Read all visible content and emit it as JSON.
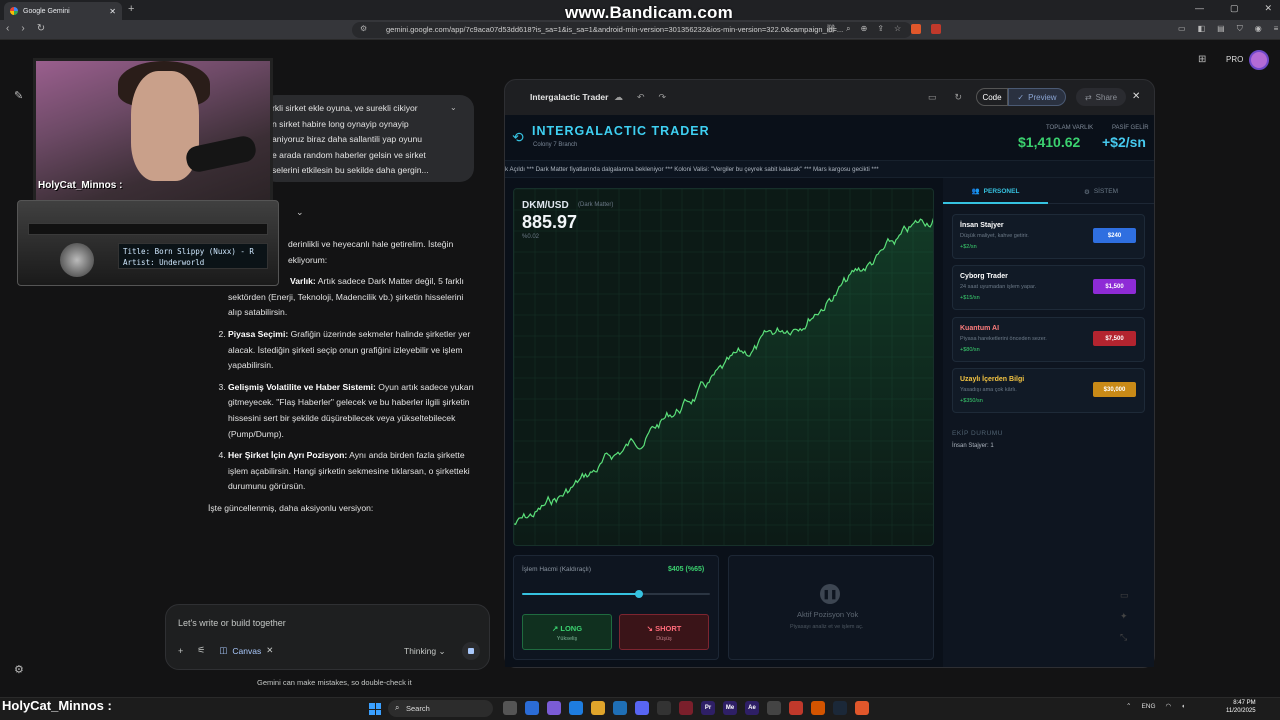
{
  "browser": {
    "tab_title": "Google Gemini",
    "url": "gemini.google.com/app/7c9aca07d53dd618?is_sa=1&is_sa=1&android-min-version=301356232&ios-min-version=322.0&campaign_id=...",
    "watermark": "www.Bandicam.com",
    "new_tab": "+",
    "close_tab": "✕"
  },
  "header": {
    "pro_label": "PRO"
  },
  "user_message": {
    "lines": [
      "rkli sirket ekle oyuna, ve surekli cikiyor",
      "n sirket habire long oynayip oynayip",
      "aniyoruz biraz daha sallantili yap oyunu",
      "e arada random haberler gelsin ve sirket",
      "selerini etkilesin bu sekilde daha gergin..."
    ]
  },
  "response": {
    "intro_1": "derinlikli ve heyecanlı hale getirelim. İsteğin",
    "intro_2": "ekliyorum:",
    "item1_bold": "Varlık:",
    "item1_text": "Artık sadece Dark Matter değil, 5 farklı sektörden (Enerji, Teknoloji, Madencilik vb.) şirketin hisselerini alıp satabilirsin.",
    "item2_bold": "Piyasa Seçimi:",
    "item2_text": "Grafiğin üzerinde sekmeler halinde şirketler yer alacak. İstediğin şirketi seçip onun grafiğini izleyebilir ve işlem yapabilirsin.",
    "item3_bold": "Gelişmiş Volatilite ve Haber Sistemi:",
    "item3_text": "Oyun artık sadece yukarı gitmeyecek. \"Flaş Haberler\" gelecek ve bu haberler ilgili şirketin hissesini sert bir şekilde düşürebilecek veya yükseltebilecek (Pump/Dump).",
    "item4_bold": "Her Şirket İçin Ayrı Pozisyon:",
    "item4_text": "Aynı anda birden fazla şirkette işlem açabilirsin. Hangi şirketin sekmesine tıklarsan, o şirketteki durumunu görürsün.",
    "outro": "İşte güncellenmiş, daha aksiyonlu versiyon:"
  },
  "prompt": {
    "placeholder": "Let's write or build together",
    "canvas_label": "Canvas",
    "thinking_label": "Thinking",
    "disclaimer": "Gemini can make mistakes, so double-check it"
  },
  "webcam": {
    "name": "HolyCat_Minnos :",
    "radio_title": "Title: Born Slippy (Nuxx) - R",
    "radio_artist": "Artist: Underworld"
  },
  "canvas_panel": {
    "title": "Intergalactic Trader",
    "code_label": "Code",
    "preview_label": "Preview",
    "share_label": "Share"
  },
  "game": {
    "title": "INTERGALACTIC TRADER",
    "subtitle": "Colony 7 Branch",
    "total_label": "TOPLAM VARLIK",
    "total_value": "$1,410.62",
    "passive_label": "PASİF GELİR",
    "passive_value": "+$2/sn",
    "ticker": "k Açıldı *** Dark Matter fiyatlarında dalgalanma bekleniyor *** Koloni Valisi: \"Vergiler bu çeyrek sabit kalacak\" *** Mars kargosu gecikti ***",
    "chart": {
      "symbol": "DKM/USD",
      "symbol_sub": "(Dark Matter)",
      "price": "885.97",
      "change": "%0.02"
    },
    "trade": {
      "volume_label": "İşlem Hacmi (Kaldıraçlı)",
      "volume_value": "$405 (%65)",
      "volume_fraction": 0.62,
      "long_label": "LONG",
      "long_sub": "Yükseliş",
      "short_label": "SHORT",
      "short_sub": "Düşüş"
    },
    "position": {
      "title": "Aktif Pozisyon Yok",
      "subtitle": "Piyasayı analiz et ve işlem aç."
    },
    "tabs": {
      "personel": "PERSONEL",
      "sistem": "SİSTEM"
    },
    "staff": [
      {
        "name": "İnsan Stajyer",
        "desc": "Düşük maliyet, kahve getirir.",
        "rate": "+$2/sn",
        "price": "$240",
        "color": "#2f6fe0",
        "name_color": "#ffffff"
      },
      {
        "name": "Cyborg Trader",
        "desc": "24 saat uyumadan işlem yapar.",
        "rate": "+$15/sn",
        "price": "$1,500",
        "color": "#8e2bd6",
        "name_color": "#ffffff"
      },
      {
        "name": "Kuantum AI",
        "desc": "Piyasa hareketlerini önceden sezer.",
        "rate": "+$80/sn",
        "price": "$7,500",
        "color": "#b3242f",
        "name_color": "#ff7d7d"
      },
      {
        "name": "Uzaylı İçerden Bilgi",
        "desc": "Yasadışı ama çok kârlı.",
        "rate": "+$350/sn",
        "price": "$30,000",
        "color": "#c98a17",
        "name_color": "#f5c542"
      }
    ],
    "team_heading": "EKİP DURUMU",
    "team_line": "İnsan Stajyer: 1",
    "chart_series_seed": 7
  },
  "taskbar": {
    "name": "HolyCat_Minnos :",
    "search": "Search",
    "lang": "ENG",
    "time": "8:47 PM",
    "date": "11/20/2025"
  }
}
